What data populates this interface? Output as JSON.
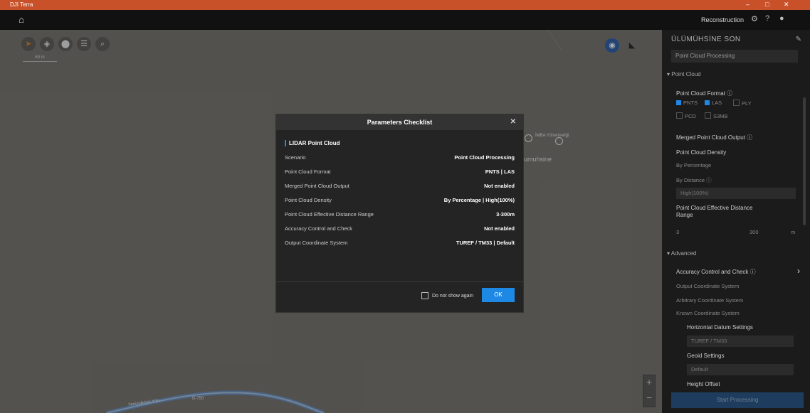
{
  "window": {
    "app_title": "DJI Terra",
    "minimize": "–",
    "maximize": "□",
    "close": "✕"
  },
  "topbar": {
    "home_glyph": "⌂",
    "mode_label": "Reconstruction",
    "settings_glyph": "⚙",
    "help_glyph": "?",
    "account_glyph": "●"
  },
  "map": {
    "toolbar": [
      {
        "name": "compass-icon",
        "glyph": "➤"
      },
      {
        "name": "locate-icon",
        "glyph": "◈"
      },
      {
        "name": "pin-icon",
        "glyph": "⬤"
      },
      {
        "name": "layers-icon",
        "glyph": "☰"
      },
      {
        "name": "search-icon",
        "glyph": "⌕"
      }
    ],
    "scale": "50 m",
    "place_label": "umuhsine",
    "poi_label": "İMBA Yönetmeliği",
    "road_label": "Yeniyolköyü Yolu",
    "road_label2": "D-750",
    "zoom_in": "+",
    "zoom_out": "−",
    "layer_glyph": "◉",
    "measure_glyph": "◣"
  },
  "dialog": {
    "title": "Parameters Checklist",
    "close_glyph": "✕",
    "section": "LIDAR Point Cloud",
    "rows": [
      {
        "key": "Scenario",
        "value": "Point Cloud Processing"
      },
      {
        "key": "Point Cloud Format",
        "value": "PNTS  |  LAS"
      },
      {
        "key": "Merged Point Cloud Output",
        "value": "Not enabled"
      },
      {
        "key": "Point Cloud Density",
        "value": "By Percentage  |  High(100%)"
      },
      {
        "key": "Point Cloud Effective Distance Range",
        "value": "3-300m"
      },
      {
        "key": "Accuracy Control and Check",
        "value": "Not enabled"
      },
      {
        "key": "Output Coordinate System",
        "value": "TUREF / TM33  |  Default"
      }
    ],
    "dont_show": "Do not show again",
    "ok": "OK"
  },
  "panel": {
    "title": "ÜLÜMÜHSİNE SON",
    "edit_glyph": "✎",
    "scenario_select": "Point Cloud Processing",
    "point_cloud_header": "▾ Point Cloud",
    "format_label": "Point Cloud Format ⓘ",
    "formats": [
      {
        "label": "PNTS",
        "checked": true
      },
      {
        "label": "LAS",
        "checked": true
      },
      {
        "label": "PLY",
        "checked": false
      },
      {
        "label": "PCD",
        "checked": false
      },
      {
        "label": "S3MB",
        "checked": false
      }
    ],
    "merged_label": "Merged Point Cloud Output ⓘ",
    "density_label": "Point Cloud Density",
    "density_opt1": "By Percentage",
    "density_opt2": "By Distance ⓘ",
    "density_select": "High(100%)",
    "range_label": "Point Cloud Effective Distance Range",
    "range_min": "3",
    "range_max": "300",
    "range_unit": "m",
    "advanced_header": "▾ Advanced",
    "accuracy_label": "Accuracy Control and Check ⓘ",
    "output_cs_label": "Output Coordinate System",
    "arbitrary_cs": "Arbitrary Coordinate System",
    "known_cs": "Known Coordinate System",
    "horizontal_label": "Horizontal Datum Settings",
    "horizontal_value": "TUREF / TM33",
    "geoid_label": "Geoid Settings",
    "geoid_value": "Default",
    "height_offset": "Height Offset",
    "start_button": "Start Processing"
  }
}
